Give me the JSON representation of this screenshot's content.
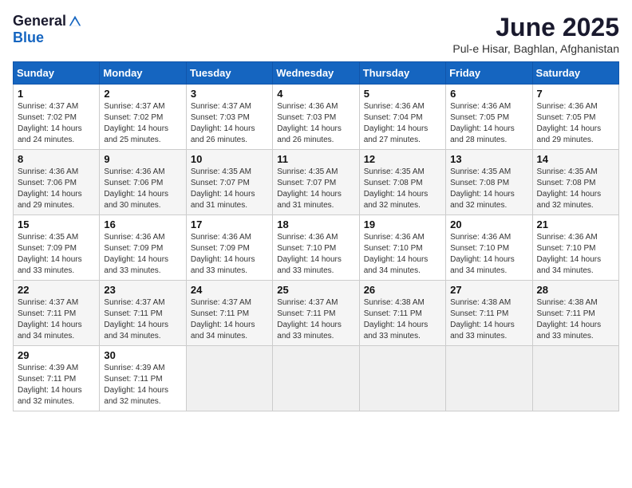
{
  "logo": {
    "general": "General",
    "blue": "Blue"
  },
  "title": "June 2025",
  "location": "Pul-e Hisar, Baghlan, Afghanistan",
  "weekdays": [
    "Sunday",
    "Monday",
    "Tuesday",
    "Wednesday",
    "Thursday",
    "Friday",
    "Saturday"
  ],
  "weeks": [
    [
      {
        "day": "1",
        "sunrise": "4:37 AM",
        "sunset": "7:02 PM",
        "daylight": "14 hours and 24 minutes."
      },
      {
        "day": "2",
        "sunrise": "4:37 AM",
        "sunset": "7:02 PM",
        "daylight": "14 hours and 25 minutes."
      },
      {
        "day": "3",
        "sunrise": "4:37 AM",
        "sunset": "7:03 PM",
        "daylight": "14 hours and 26 minutes."
      },
      {
        "day": "4",
        "sunrise": "4:36 AM",
        "sunset": "7:03 PM",
        "daylight": "14 hours and 26 minutes."
      },
      {
        "day": "5",
        "sunrise": "4:36 AM",
        "sunset": "7:04 PM",
        "daylight": "14 hours and 27 minutes."
      },
      {
        "day": "6",
        "sunrise": "4:36 AM",
        "sunset": "7:05 PM",
        "daylight": "14 hours and 28 minutes."
      },
      {
        "day": "7",
        "sunrise": "4:36 AM",
        "sunset": "7:05 PM",
        "daylight": "14 hours and 29 minutes."
      }
    ],
    [
      {
        "day": "8",
        "sunrise": "4:36 AM",
        "sunset": "7:06 PM",
        "daylight": "14 hours and 29 minutes."
      },
      {
        "day": "9",
        "sunrise": "4:36 AM",
        "sunset": "7:06 PM",
        "daylight": "14 hours and 30 minutes."
      },
      {
        "day": "10",
        "sunrise": "4:35 AM",
        "sunset": "7:07 PM",
        "daylight": "14 hours and 31 minutes."
      },
      {
        "day": "11",
        "sunrise": "4:35 AM",
        "sunset": "7:07 PM",
        "daylight": "14 hours and 31 minutes."
      },
      {
        "day": "12",
        "sunrise": "4:35 AM",
        "sunset": "7:08 PM",
        "daylight": "14 hours and 32 minutes."
      },
      {
        "day": "13",
        "sunrise": "4:35 AM",
        "sunset": "7:08 PM",
        "daylight": "14 hours and 32 minutes."
      },
      {
        "day": "14",
        "sunrise": "4:35 AM",
        "sunset": "7:08 PM",
        "daylight": "14 hours and 32 minutes."
      }
    ],
    [
      {
        "day": "15",
        "sunrise": "4:35 AM",
        "sunset": "7:09 PM",
        "daylight": "14 hours and 33 minutes."
      },
      {
        "day": "16",
        "sunrise": "4:36 AM",
        "sunset": "7:09 PM",
        "daylight": "14 hours and 33 minutes."
      },
      {
        "day": "17",
        "sunrise": "4:36 AM",
        "sunset": "7:09 PM",
        "daylight": "14 hours and 33 minutes."
      },
      {
        "day": "18",
        "sunrise": "4:36 AM",
        "sunset": "7:10 PM",
        "daylight": "14 hours and 33 minutes."
      },
      {
        "day": "19",
        "sunrise": "4:36 AM",
        "sunset": "7:10 PM",
        "daylight": "14 hours and 34 minutes."
      },
      {
        "day": "20",
        "sunrise": "4:36 AM",
        "sunset": "7:10 PM",
        "daylight": "14 hours and 34 minutes."
      },
      {
        "day": "21",
        "sunrise": "4:36 AM",
        "sunset": "7:10 PM",
        "daylight": "14 hours and 34 minutes."
      }
    ],
    [
      {
        "day": "22",
        "sunrise": "4:37 AM",
        "sunset": "7:11 PM",
        "daylight": "14 hours and 34 minutes."
      },
      {
        "day": "23",
        "sunrise": "4:37 AM",
        "sunset": "7:11 PM",
        "daylight": "14 hours and 34 minutes."
      },
      {
        "day": "24",
        "sunrise": "4:37 AM",
        "sunset": "7:11 PM",
        "daylight": "14 hours and 34 minutes."
      },
      {
        "day": "25",
        "sunrise": "4:37 AM",
        "sunset": "7:11 PM",
        "daylight": "14 hours and 33 minutes."
      },
      {
        "day": "26",
        "sunrise": "4:38 AM",
        "sunset": "7:11 PM",
        "daylight": "14 hours and 33 minutes."
      },
      {
        "day": "27",
        "sunrise": "4:38 AM",
        "sunset": "7:11 PM",
        "daylight": "14 hours and 33 minutes."
      },
      {
        "day": "28",
        "sunrise": "4:38 AM",
        "sunset": "7:11 PM",
        "daylight": "14 hours and 33 minutes."
      }
    ],
    [
      {
        "day": "29",
        "sunrise": "4:39 AM",
        "sunset": "7:11 PM",
        "daylight": "14 hours and 32 minutes."
      },
      {
        "day": "30",
        "sunrise": "4:39 AM",
        "sunset": "7:11 PM",
        "daylight": "14 hours and 32 minutes."
      },
      null,
      null,
      null,
      null,
      null
    ]
  ]
}
